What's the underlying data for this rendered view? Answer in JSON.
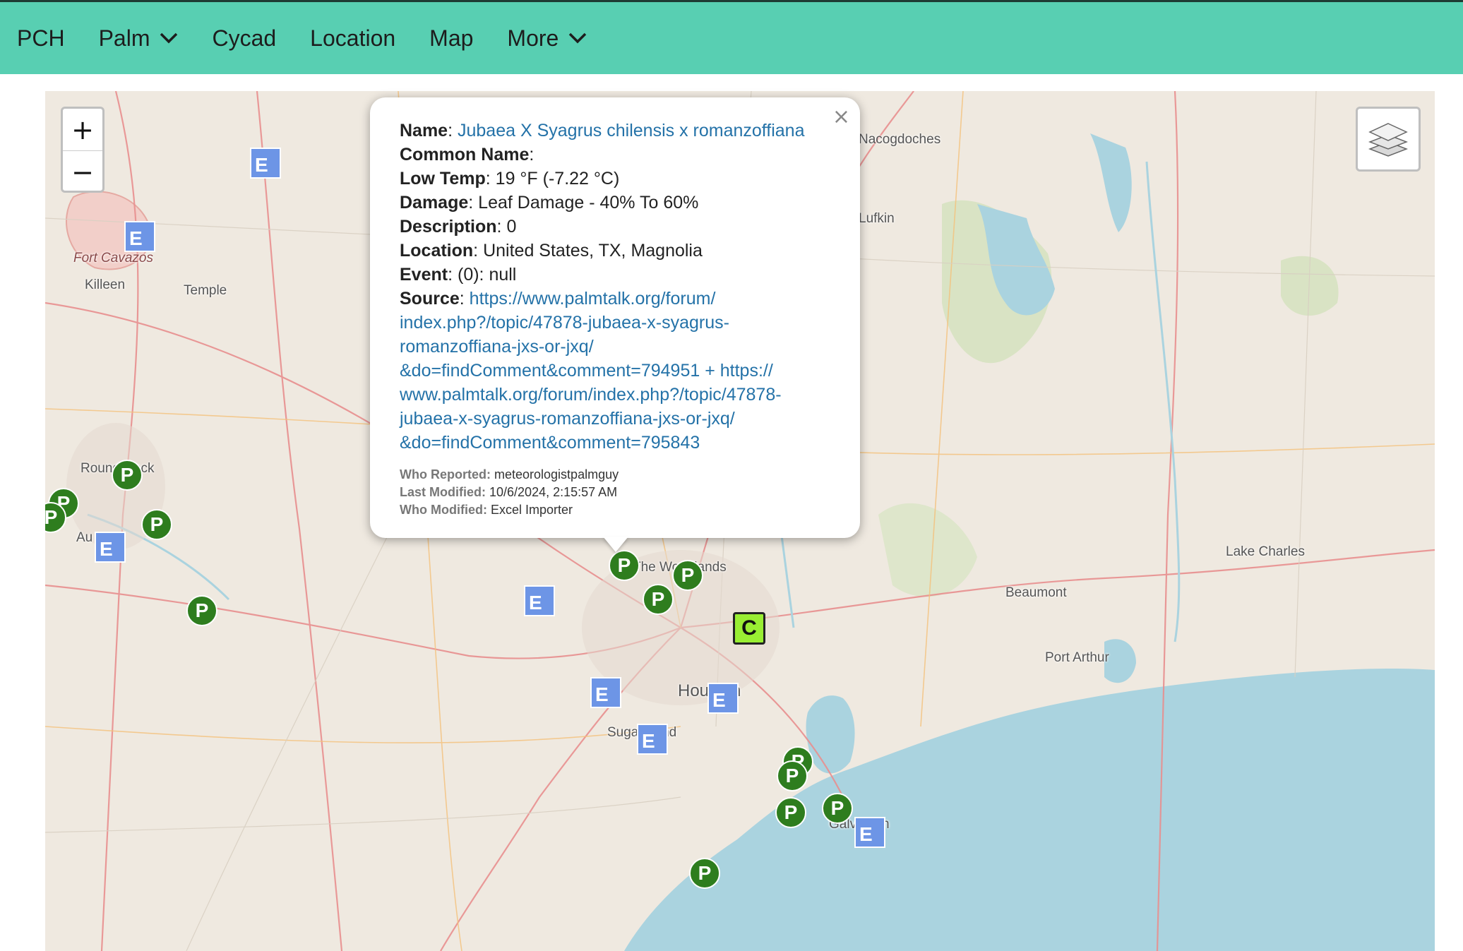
{
  "nav": {
    "brand": "PCH",
    "items": [
      {
        "label": "Palm",
        "dropdown": true
      },
      {
        "label": "Cycad",
        "dropdown": false
      },
      {
        "label": "Location",
        "dropdown": false
      },
      {
        "label": "Map",
        "dropdown": false
      },
      {
        "label": "More",
        "dropdown": true
      }
    ]
  },
  "map": {
    "zoom_in": "+",
    "zoom_out": "−",
    "place_labels": {
      "fort_cavazos": "Fort Cavazos",
      "killeen": "Killeen",
      "temple": "Temple",
      "round_rock": "Round Rock",
      "austin": "Au",
      "nacogdoches": "Nacogdoches",
      "lufkin": "Lufkin",
      "the_woodlands": "The Woodlands",
      "houston": "Houston",
      "sugar_land": "Sugar Land",
      "galveston": "Galveston",
      "beaumont": "Beaumont",
      "port_arthur": "Port Arthur",
      "lake_charles": "Lake Charles"
    },
    "markers": {
      "palm_letter": "P",
      "event_letter": "E",
      "cycad_letter": "C"
    },
    "colors": {
      "palm": "#2e7d1e",
      "event": "#6d95e6",
      "cycad": "#99ee33",
      "water": "#aad3df",
      "land": "#efe9e0"
    }
  },
  "popup": {
    "close": "×",
    "name_label": "Name",
    "name_value": "Jubaea X Syagrus chilensis x romanzoffiana",
    "common_name_label": "Common Name",
    "common_name_value": "",
    "low_temp_label": "Low Temp",
    "low_temp_value": "19 °F (-7.22 °C)",
    "damage_label": "Damage",
    "damage_value": "Leaf Damage - 40% To 60%",
    "description_label": "Description",
    "description_value": "0",
    "location_label": "Location",
    "location_value": "United States, TX, Magnolia",
    "event_label": "Event",
    "event_value": "(0): null",
    "source_label": "Source",
    "source_lines": [
      "https://www.palmtalk.org/forum/",
      "index.php?/topic/47878-jubaea-x-syagrus-",
      "romanzoffiana-jxs-or-jxq/",
      "&do=findComment&comment=794951 + https://",
      "www.palmtalk.org/forum/index.php?/topic/47878-",
      "jubaea-x-syagrus-romanzoffiana-jxs-or-jxq/",
      "&do=findComment&comment=795843"
    ],
    "who_reported_label": "Who Reported:",
    "who_reported_value": "meteorologistpalmguy",
    "last_modified_label": "Last Modified:",
    "last_modified_value": "10/6/2024, 2:15:57 AM",
    "who_modified_label": "Who Modified:",
    "who_modified_value": "Excel Importer"
  }
}
